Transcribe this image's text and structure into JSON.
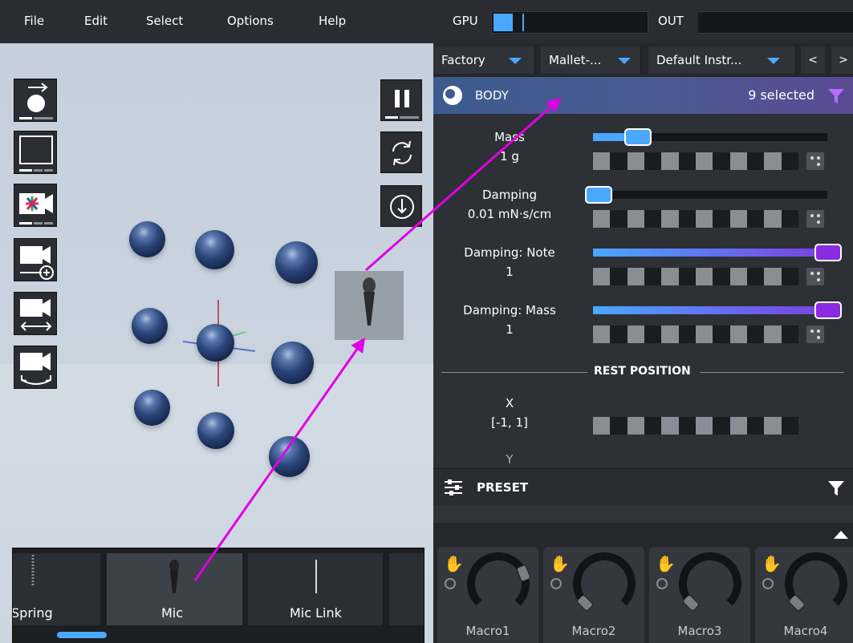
{
  "menu": {
    "items": [
      "File",
      "Edit",
      "Select",
      "Options",
      "Help"
    ],
    "gpu_label": "GPU",
    "gpu_level": 0.05,
    "out_label": "OUT"
  },
  "toolbar_left": {
    "icons": [
      "add-sphere-icon",
      "viewport-frame-icon",
      "color-camera-icon",
      "add-camera-icon",
      "camera-pan-icon",
      "camera-orbit-icon"
    ]
  },
  "toolbar_right": {
    "icons": [
      "pause-icon",
      "refresh-icon",
      "download-icon"
    ]
  },
  "tray": {
    "items": [
      {
        "label": "Spring",
        "icon": "spring-icon"
      },
      {
        "label": "Mic",
        "icon": "mic-icon"
      },
      {
        "label": "Mic Link",
        "icon": "link-line-icon"
      }
    ]
  },
  "dropdowns": {
    "library": "Factory",
    "category": "Mallet-...",
    "instrument": "Default Instr...",
    "prev": "<",
    "next": ">"
  },
  "body_section": {
    "title": "BODY",
    "selection": "9 selected",
    "params": [
      {
        "label": "Mass",
        "value": "1 g",
        "level": 0.15
      },
      {
        "label": "Damping",
        "value": "0.01 mN·s/cm",
        "level": 0.02
      },
      {
        "label": "Damping: Note",
        "value": "1",
        "level": 1.0
      },
      {
        "label": "Damping: Mass",
        "value": "1",
        "level": 1.0
      }
    ],
    "rest_position_label": "REST POSITION",
    "x_label": "X",
    "x_value": "[-1, 1]",
    "y_label": "Y"
  },
  "preset_section": {
    "title": "PRESET"
  },
  "macros": {
    "items": [
      "Macro1",
      "Macro2",
      "Macro3",
      "Macro4"
    ],
    "levels": [
      0.75,
      0.0,
      0.0,
      0.0
    ]
  },
  "colors": {
    "accent_blue": "#4aa8ff",
    "accent_purple": "#7b3fe0",
    "annotation_magenta": "#e000e6",
    "panel_bg": "#2d3035"
  }
}
